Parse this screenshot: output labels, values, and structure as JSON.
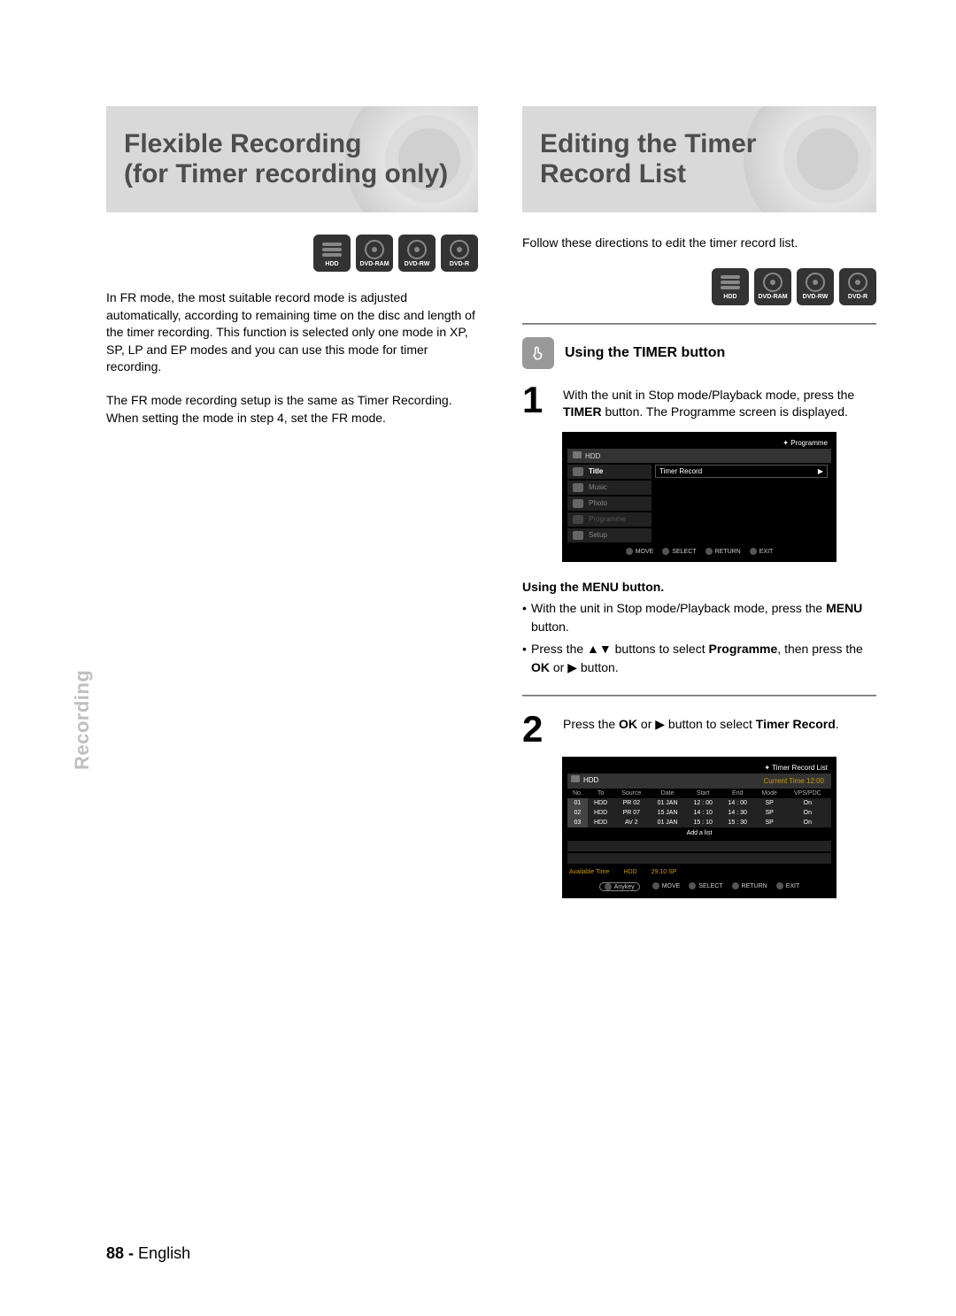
{
  "side_label": "Recording",
  "left": {
    "banner_line1": "Flexible Recording",
    "banner_line2": "(for Timer recording only)",
    "badges": [
      "HDD",
      "DVD-RAM",
      "DVD-RW",
      "DVD-R"
    ],
    "para1": "In FR mode, the most suitable record mode is adjusted automatically, according to remaining time on the disc and length of the timer recording. This function is selected only one mode in XP, SP, LP and EP modes and you can use this mode for timer recording.",
    "para2": "The FR mode recording setup is the same as Timer Recording. When setting the mode in step 4, set the FR mode."
  },
  "right": {
    "banner_line1": "Editing the Timer",
    "banner_line2": "Record List",
    "intro": "Follow these directions to edit the timer record list.",
    "badges": [
      "HDD",
      "DVD-RAM",
      "DVD-RW",
      "DVD-R"
    ],
    "section1_title": "Using the TIMER button",
    "step1_num": "1",
    "step1_text_a": "With the unit in Stop mode/Playback mode, press the ",
    "step1_text_b": "TIMER",
    "step1_text_c": " button. The Programme screen is displayed.",
    "screen1": {
      "title": "✦  Programme",
      "device": "HDD",
      "items": [
        {
          "icon": "title",
          "label": "Title",
          "selected": true
        },
        {
          "icon": "music",
          "label": "Music"
        },
        {
          "icon": "photo",
          "label": "Photo"
        },
        {
          "icon": "programme",
          "label": "Programme",
          "dim": true
        },
        {
          "icon": "setup",
          "label": "Setup"
        }
      ],
      "rightbox": "Timer Record",
      "footer": [
        "MOVE",
        "SELECT",
        "RETURN",
        "EXIT"
      ]
    },
    "sub2_title": "Using the MENU button.",
    "sub2_b1_a": "With the unit in Stop mode/Playback mode, press the ",
    "sub2_b1_b": "MENU",
    "sub2_b1_c": " button.",
    "sub2_b2_a": "Press the ▲▼ buttons to select ",
    "sub2_b2_b": "Programme",
    "sub2_b2_c": ", then press the ",
    "sub2_b2_d": "OK",
    "sub2_b2_e": " or ▶ button.",
    "step2_num": "2",
    "step2_a": "Press the ",
    "step2_b": "OK",
    "step2_c": " or ▶ button to select ",
    "step2_d": "Timer Record",
    "step2_e": ".",
    "screen2": {
      "title": "✦   Timer Record List",
      "device": "HDD",
      "curtime": "Current Time 12:00",
      "headers": [
        "No.",
        "To",
        "Source",
        "Date",
        "Start",
        "End",
        "Mode",
        "VPS/PDC"
      ],
      "rows": [
        [
          "01",
          "HDD",
          "PR 02",
          "01 JAN",
          "12 : 00",
          "14 : 00",
          "SP",
          "On"
        ],
        [
          "02",
          "HDD",
          "PR 07",
          "15 JAN",
          "14 : 10",
          "14 : 30",
          "SP",
          "On"
        ],
        [
          "03",
          "HDD",
          "AV 2",
          "01 JAN",
          "15 : 10",
          "15 : 30",
          "SP",
          "On"
        ]
      ],
      "add": "Add a list",
      "avail_label": "Available Time",
      "avail_dev": "HDD",
      "avail_val": "29:10  SP",
      "anykey": "Anykey",
      "footer": [
        "MOVE",
        "SELECT",
        "RETURN",
        "EXIT"
      ]
    }
  },
  "footer": {
    "page": "88 -",
    "lang": "English"
  }
}
